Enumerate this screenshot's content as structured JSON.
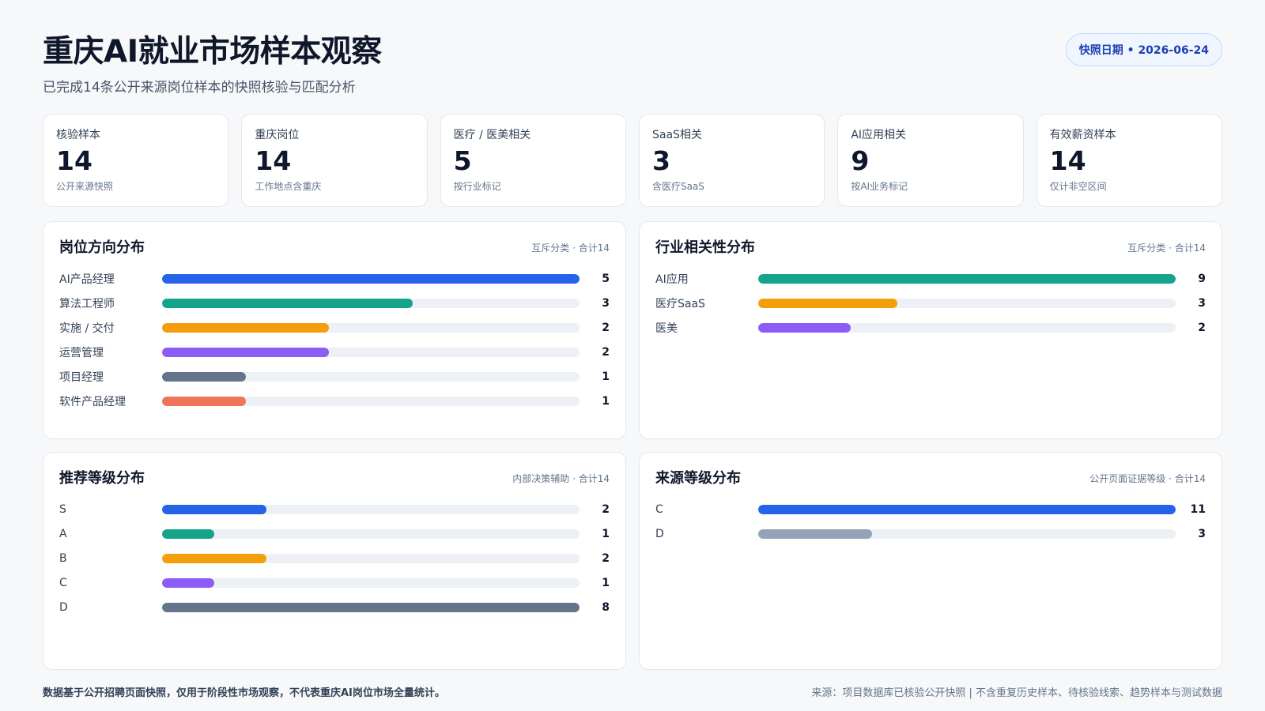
{
  "header": {
    "title": "重庆AI就业市场样本观察",
    "subtitle": "已完成14条公开来源岗位样本的快照核验与匹配分析",
    "badge": "快照日期 • 2026-06-24"
  },
  "kpis": [
    {
      "label": "核验样本",
      "value": "14",
      "note": "公开来源快照"
    },
    {
      "label": "重庆岗位",
      "value": "14",
      "note": "工作地点含重庆"
    },
    {
      "label": "医疗 / 医美相关",
      "value": "5",
      "note": "按行业标记"
    },
    {
      "label": "SaaS相关",
      "value": "3",
      "note": "含医疗SaaS"
    },
    {
      "label": "AI应用相关",
      "value": "9",
      "note": "按AI业务标记"
    },
    {
      "label": "有效薪资样本",
      "value": "14",
      "note": "仅计非空区间"
    }
  ],
  "colors": {
    "blue": "#2563eb",
    "teal": "#14a38b",
    "amber": "#f59e0b",
    "violet": "#8b5cf6",
    "slate": "#64748b",
    "coral": "#ee7558",
    "gray": "#94a3b8",
    "track": "#edf0f4"
  },
  "chart_data": [
    {
      "type": "bar",
      "title": "岗位方向分布",
      "note": "互斥分类 · 合计14",
      "categories": [
        "AI产品经理",
        "算法工程师",
        "实施 / 交付",
        "运营管理",
        "项目经理",
        "软件产品经理"
      ],
      "values": [
        5,
        3,
        2,
        2,
        1,
        1
      ],
      "colors": [
        "#2563eb",
        "#14a38b",
        "#f59e0b",
        "#8b5cf6",
        "#64748b",
        "#ee7558"
      ],
      "xlim": [
        0,
        5
      ]
    },
    {
      "type": "bar",
      "title": "行业相关性分布",
      "note": "互斥分类 · 合计14",
      "categories": [
        "AI应用",
        "医疗SaaS",
        "医美"
      ],
      "values": [
        9,
        3,
        2
      ],
      "colors": [
        "#14a38b",
        "#f59e0b",
        "#8b5cf6"
      ],
      "xlim": [
        0,
        9
      ]
    },
    {
      "type": "bar",
      "title": "推荐等级分布",
      "note": "内部决策辅助 · 合计14",
      "categories": [
        "S",
        "A",
        "B",
        "C",
        "D"
      ],
      "values": [
        2,
        1,
        2,
        1,
        8
      ],
      "colors": [
        "#2563eb",
        "#14a38b",
        "#f59e0b",
        "#8b5cf6",
        "#64748b"
      ],
      "xlim": [
        0,
        8
      ]
    },
    {
      "type": "bar",
      "title": "来源等级分布",
      "note": "公开页面证据等级 · 合计14",
      "categories": [
        "C",
        "D"
      ],
      "values": [
        11,
        3
      ],
      "colors": [
        "#2563eb",
        "#94a3b8"
      ],
      "xlim": [
        0,
        11
      ]
    }
  ],
  "footer": {
    "left": "数据基于公开招聘页面快照，仅用于阶段性市场观察，不代表重庆AI岗位市场全量统计。",
    "right": "来源：项目数据库已核验公开快照 | 不含重复历史样本、待核验线索、趋势样本与测试数据"
  }
}
